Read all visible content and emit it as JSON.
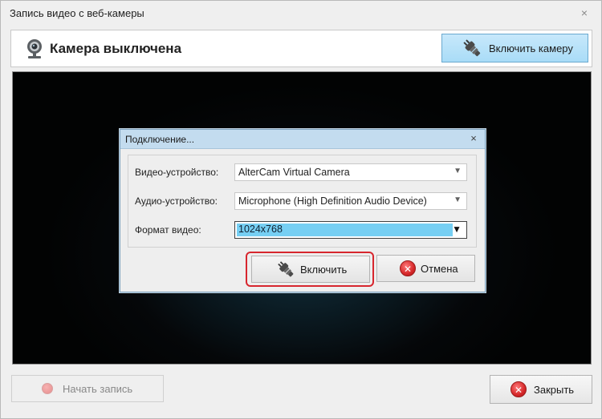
{
  "window": {
    "title": "Запись видео с веб-камеры",
    "close_glyph": "×"
  },
  "header": {
    "status_icon": "webcam-icon",
    "status_text": "Камера выключена",
    "enable_camera_label": "Включить камеру",
    "enable_camera_icon": "plug-icon"
  },
  "dialog": {
    "title": "Подключение...",
    "close_glyph": "×",
    "fields": [
      {
        "label": "Видео-устройство:",
        "value": "AlterCam Virtual Camera"
      },
      {
        "label": "Аудио-устройство:",
        "value": "Microphone (High Definition Audio Device)"
      },
      {
        "label": "Формат видео:",
        "value": "1024x768"
      }
    ],
    "connect_label": "Включить",
    "cancel_label": "Отмена"
  },
  "footer": {
    "start_record_label": "Начать запись",
    "close_label": "Закрыть"
  },
  "colors": {
    "accent_button": "#a9dcf7",
    "highlight_ring": "#d7262e",
    "selected_combo": "#76cff3"
  }
}
